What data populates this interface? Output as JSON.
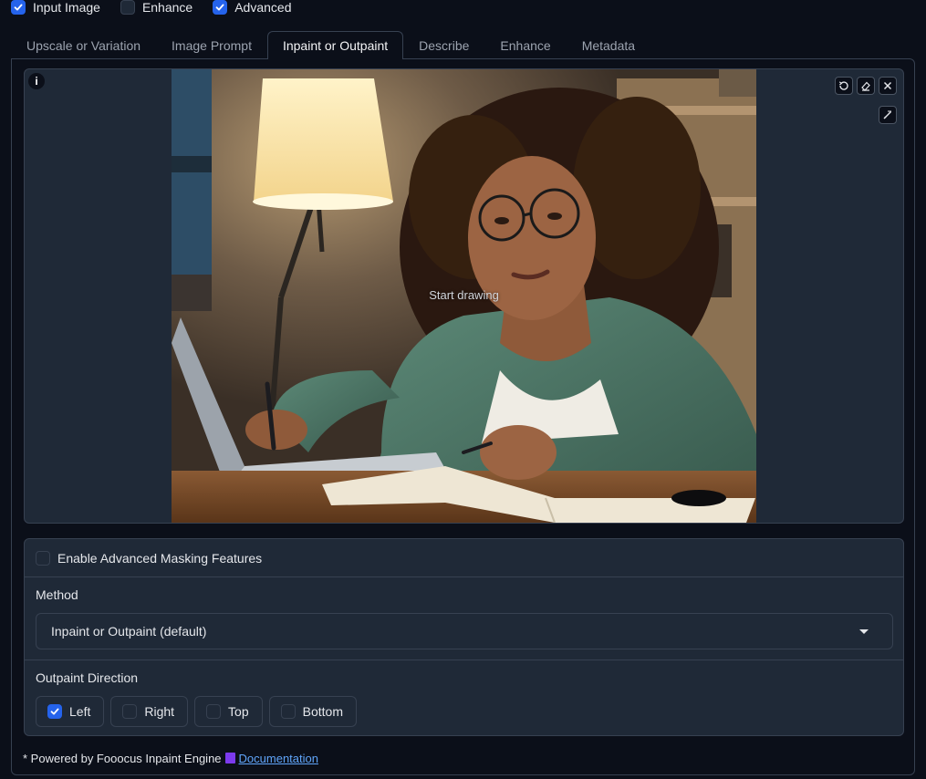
{
  "top_checks": [
    {
      "label": "Input Image",
      "checked": true
    },
    {
      "label": "Enhance",
      "checked": false
    },
    {
      "label": "Advanced",
      "checked": true
    }
  ],
  "tabs": [
    {
      "label": "Upscale or Variation",
      "active": false
    },
    {
      "label": "Image Prompt",
      "active": false
    },
    {
      "label": "Inpaint or Outpaint",
      "active": true
    },
    {
      "label": "Describe",
      "active": false
    },
    {
      "label": "Enhance",
      "active": false
    },
    {
      "label": "Metadata",
      "active": false
    }
  ],
  "canvas": {
    "info_icon": "i",
    "placeholder": "Start drawing",
    "tools": [
      "undo-icon",
      "eraser-icon",
      "close-icon",
      "brush-icon"
    ]
  },
  "masking": {
    "enable_label": "Enable Advanced Masking Features",
    "enable_checked": false,
    "method_label": "Method",
    "method_value": "Inpaint or Outpaint (default)",
    "direction_label": "Outpaint Direction",
    "directions": [
      {
        "label": "Left",
        "checked": true
      },
      {
        "label": "Right",
        "checked": false
      },
      {
        "label": "Top",
        "checked": false
      },
      {
        "label": "Bottom",
        "checked": false
      }
    ]
  },
  "footer": {
    "text": "* Powered by Fooocus Inpaint Engine",
    "link": "Documentation",
    "book_icon": "book-icon"
  },
  "colors": {
    "background": "#0b0f19",
    "panel": "#1f2937",
    "border": "#374151",
    "accent": "#2563eb",
    "link": "#60a5fa"
  }
}
